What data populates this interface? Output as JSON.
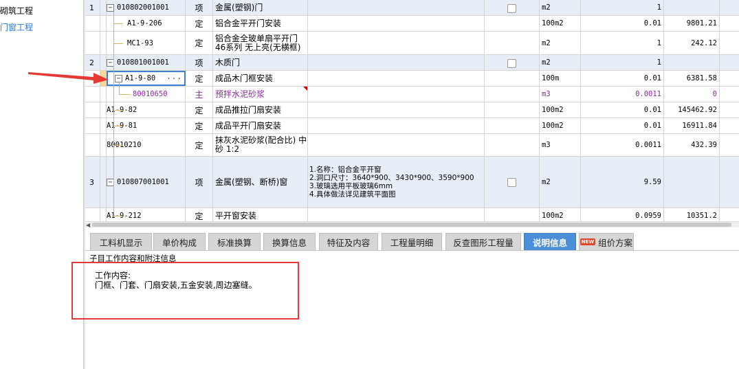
{
  "left_tree": {
    "items": [
      {
        "label": "砌筑工程"
      },
      {
        "label": "门窗工程"
      }
    ]
  },
  "grid": {
    "rows": [
      {
        "no": "1",
        "code": "010802001001",
        "type": "项",
        "name": "金属(塑钢)门",
        "features": "",
        "unit": "m2",
        "quantity": "1",
        "price": ""
      },
      {
        "no": "",
        "code": "A1-9-206",
        "type": "定",
        "name": "铝合金平开门安装",
        "features": "",
        "unit": "100m2",
        "quantity": "0.01",
        "price": "9801.21"
      },
      {
        "no": "",
        "code": "MC1-93",
        "type": "定",
        "name": "铝合金全玻单扇平开门46系列 无上亮(无横框)",
        "features": "",
        "unit": "m2",
        "quantity": "1",
        "price": "242.12"
      },
      {
        "no": "2",
        "code": "010801001001",
        "type": "项",
        "name": "木质门",
        "features": "",
        "unit": "m2",
        "quantity": "1",
        "price": ""
      },
      {
        "no": "",
        "code": "A1-9-80",
        "type": "定",
        "name": "成品木门框安装",
        "features": "",
        "unit": "100m",
        "quantity": "0.01",
        "price": "6381.58"
      },
      {
        "no": "",
        "code": "80010650",
        "type": "主",
        "name": "预拌水泥砂浆",
        "features": "",
        "unit": "m3",
        "quantity": "0.0011",
        "price": "0"
      },
      {
        "no": "",
        "code": "A1-9-82",
        "type": "定",
        "name": "成品推拉门扇安装",
        "features": "",
        "unit": "100m2",
        "quantity": "0.01",
        "price": "145462.92"
      },
      {
        "no": "",
        "code": "A1-9-81",
        "type": "定",
        "name": "成品平开门扇安装",
        "features": "",
        "unit": "100m2",
        "quantity": "0.01",
        "price": "16911.84"
      },
      {
        "no": "",
        "code": "80010210",
        "type": "定",
        "name": "抹灰水泥砂浆(配合比) 中砂 1:2",
        "features": "",
        "unit": "m3",
        "quantity": "0.0011",
        "price": "432.39"
      },
      {
        "no": "3",
        "code": "010807001001",
        "type": "项",
        "name": "金属(塑钢、断桥)窗",
        "features": "1.名称：铝合金平开窗\n2.洞口尺寸：3640*900、3430*900、3590*900\n3.玻璃选用平板玻璃6mm\n4.具体做法详见建筑平面图",
        "unit": "m2",
        "quantity": "9.59",
        "price": ""
      },
      {
        "no": "",
        "code": "A1-9-212",
        "type": "定",
        "name": "平开窗安装",
        "features": "",
        "unit": "100m2",
        "quantity": "0.0959",
        "price": "10351.2"
      }
    ]
  },
  "tabs": {
    "items": [
      {
        "label": "工料机显示"
      },
      {
        "label": "单价构成"
      },
      {
        "label": "标准换算"
      },
      {
        "label": "换算信息"
      },
      {
        "label": "特征及内容"
      },
      {
        "label": "工程量明细"
      },
      {
        "label": "反查图形工程量"
      },
      {
        "label": "说明信息"
      },
      {
        "label": "组价方案",
        "badge": "NEW"
      }
    ],
    "active_index": 7
  },
  "description": {
    "header": "子目工作内容和附注信息",
    "title": "工作内容:",
    "body": "门框、门套、门扇安装,五金安装,周边塞缝。"
  },
  "colors": {
    "item_row_bg": "#e8eef8",
    "active_tab": "#4a8fd8",
    "highlight": "#e03a3a",
    "link_blue": "#2a79d4",
    "material_purple": "#8b2a9b"
  }
}
